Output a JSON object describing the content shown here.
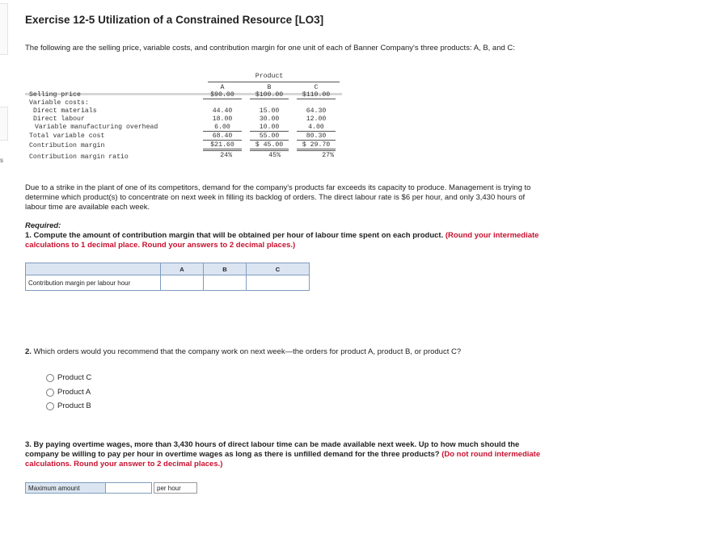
{
  "exercise": {
    "title": "Exercise 12-5 Utilization of a Constrained Resource [LO3]",
    "intro": "The following are the selling price, variable costs, and contribution margin for one unit of each of Banner Company's three products: A, B, and C:"
  },
  "side_letter": "s",
  "data_table": {
    "product_label": "Product",
    "headers": [
      "A",
      "B",
      "C"
    ],
    "rows": {
      "selling_price": {
        "label": "Selling price",
        "values": [
          "$90.00",
          "$100.00",
          "$110.00"
        ]
      },
      "variable_costs": {
        "label": "Variable costs:"
      },
      "direct_materials": {
        "label": "Direct materials",
        "values": [
          "44.40",
          "15.00",
          "64.30"
        ]
      },
      "direct_labour": {
        "label": "Direct labour",
        "values": [
          "18.00",
          "30.00",
          "12.00"
        ]
      },
      "variable_mfg_overhead": {
        "label": "Variable manufacturing overhead",
        "values": [
          "6.00",
          "10.00",
          "4.00"
        ]
      },
      "total_variable_cost": {
        "label": "Total variable cost",
        "values": [
          "68.40",
          "55.00",
          "80.30"
        ]
      },
      "contribution_margin": {
        "label": "Contribution margin",
        "values": [
          "$21.60",
          "$ 45.00",
          "$ 29.70"
        ]
      },
      "cm_ratio": {
        "label": "Contribution margin ratio",
        "values": [
          "24%",
          "45%",
          "27%"
        ]
      }
    }
  },
  "scenario": "Due to a strike in the plant of one of its competitors, demand for the company's products far exceeds its capacity to produce. Management is trying to determine which product(s) to concentrate on next week in filling its backlog of orders. The direct labour rate is $6 per hour, and only 3,430 hours of labour time are available each week.",
  "required": {
    "heading": "Required:",
    "q1_text": "1. Compute the amount of contribution margin that will be obtained per hour of labour time spent on each product.",
    "q1_note": "(Round your intermediate calculations to 1 decimal place. Round your answers to 2 decimal places.)"
  },
  "answer_table": {
    "headers": [
      "A",
      "B",
      "C"
    ],
    "row_label": "Contribution margin per labour hour",
    "values": [
      "",
      "",
      ""
    ]
  },
  "q2": {
    "number": "2.",
    "text": "Which orders would you recommend that the company work on next week—the orders for product A, product B, or product C?",
    "options": [
      "Product C",
      "Product A",
      "Product B"
    ]
  },
  "q3": {
    "text": "3. By paying overtime wages, more than 3,430 hours of direct labour time can be made available next week. Up to how much should the company be willing to pay per hour in overtime wages as long as there is unfilled demand for the three products?",
    "note": "(Do not round intermediate calculations. Round your answer to 2 decimal places.)",
    "max_label": "Maximum amount",
    "max_value": "",
    "unit": "per hour"
  }
}
